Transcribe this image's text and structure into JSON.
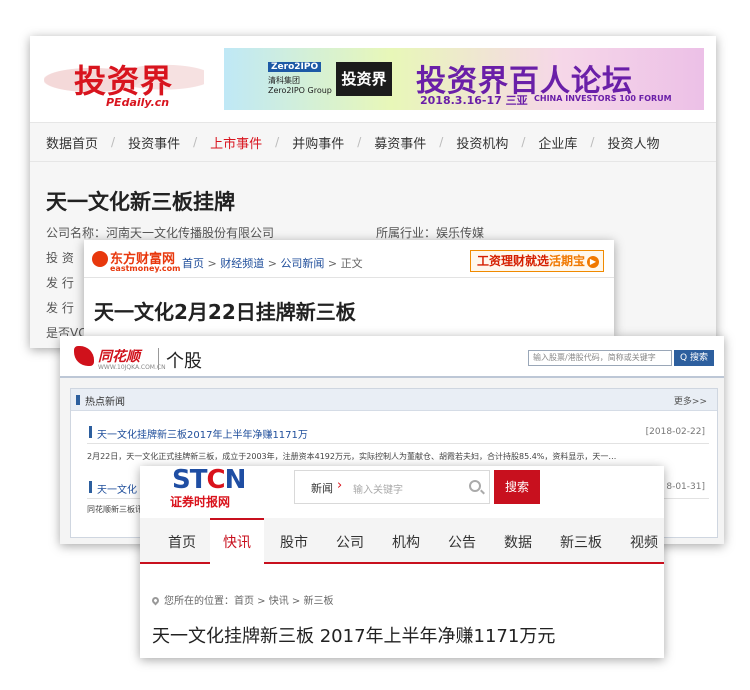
{
  "pedaily": {
    "logo_cn": "投资界",
    "logo_en": "PEdaily.cn",
    "banner": {
      "zero_line": "Zero2IPO",
      "group_line": "清科集团 Zero2IPO Group",
      "logo_box": "投资界",
      "title": "投资界百人论坛",
      "date": "2018.3.16-17 三亚",
      "subtitle_en": "CHINA INVESTORS 100 FORUM"
    },
    "nav": [
      "数据首页",
      "投资事件",
      "上市事件",
      "并购事件",
      "募资事件",
      "投资机构",
      "企业库",
      "投资人物"
    ],
    "nav_active_index": 2,
    "title": "天一文化新三板挂牌",
    "company_label": "公司名称：河南天一文化传播股份有限公司",
    "industry_label": "所属行业：娱乐传媒",
    "field_investor": "投 资",
    "field_issue1": "发 行",
    "field_issue2": "发 行",
    "field_vc": "是否VC"
  },
  "eastmoney": {
    "logo_cn": "东方财富网",
    "logo_en": "eastmoney.com",
    "crumb": [
      "首页",
      "财经频道",
      "公司新闻",
      "正文"
    ],
    "ad_text": "工资理财就选",
    "ad_highlight": "活期宝",
    "title": "天一文化2月22日挂牌新三板"
  },
  "ths": {
    "logo_cn": "同花顺",
    "logo_en": "WWW.10JQKA.COM.CN",
    "section": "个股",
    "search_placeholder": "输入股票/港股代码，简称或关键字",
    "search_button": "Q 搜索",
    "panel_title": "热点新闻",
    "more": "更多>>",
    "news": [
      {
        "title": "天一文化挂牌新三板2017年上半年净赚1171万",
        "date": "[2018-02-22]",
        "summary": "2月22日，天一文化正式挂牌新三板，成立于2003年，注册资本4192万元，实际控制人为董献仓、胡霞若夫妇，合计持股85.4%，资料显示，天一…"
      },
      {
        "title": "天一文化",
        "date": "8-01-31]",
        "summary": "同花顺新三板讯"
      }
    ]
  },
  "stcn": {
    "logo_en_a": "ST",
    "logo_en_b": "C",
    "logo_en_c": "N",
    "logo_cn": "证券时报网",
    "search_select": "新闻",
    "search_placeholder": "输入关键字",
    "search_button": "搜索",
    "nav": [
      "首页",
      "快讯",
      "股市",
      "公司",
      "机构",
      "公告",
      "数据",
      "新三板",
      "视频"
    ],
    "nav_active_index": 1,
    "location": "您所在的位置：首页 > 快讯 > 新三板",
    "title": "天一文化挂牌新三板 2017年上半年净赚1171万元"
  },
  "colors": {
    "pedaily_red": "#d8141e",
    "eastmoney_orange": "#e8380d",
    "ths_blue": "#2d5f9e",
    "stcn_red": "#c8101e"
  }
}
